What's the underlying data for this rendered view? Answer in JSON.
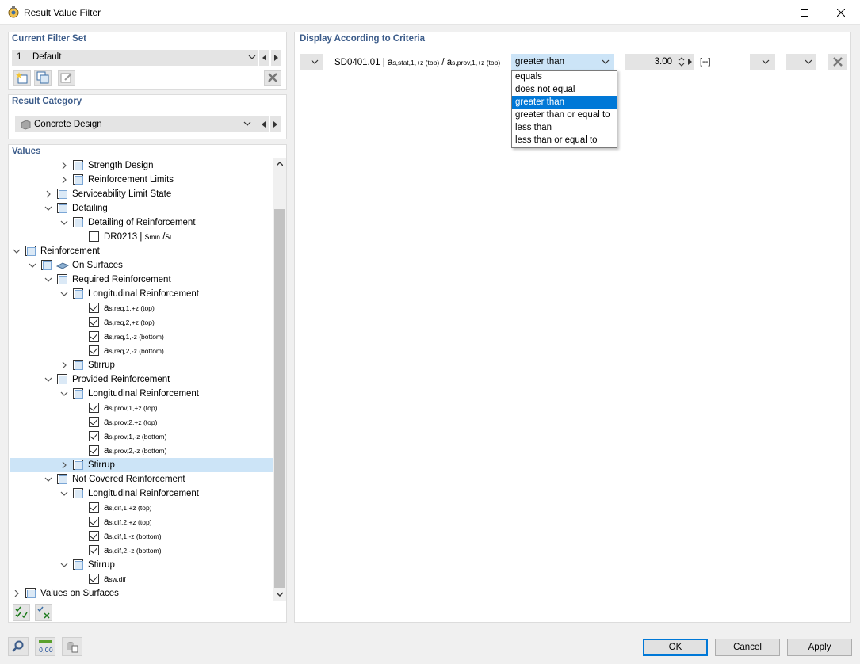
{
  "window": {
    "title": "Result Value Filter"
  },
  "current_filter_set": {
    "heading": "Current Filter Set",
    "number": "1",
    "name": "Default"
  },
  "result_category": {
    "heading": "Result Category",
    "value": "Concrete Design"
  },
  "values": {
    "heading": "Values",
    "tree": [
      {
        "label": "Strength Design",
        "expand": "collapsed",
        "check": "partial"
      },
      {
        "label": "Reinforcement Limits",
        "expand": "collapsed",
        "check": "partial"
      },
      {
        "label": "Serviceability Limit State",
        "expand": "collapsed",
        "check": "partial"
      },
      {
        "label": "Detailing",
        "expand": "expanded",
        "check": "partial"
      },
      {
        "label": "Detailing of Reinforcement",
        "expand": "expanded",
        "check": "partial"
      },
      {
        "label": "DR0213 | ",
        "sym": "s",
        "sub": "min",
        "tail": " /s",
        "tail_sub": "l",
        "check": "unchecked"
      },
      {
        "label": "Reinforcement",
        "expand": "expanded",
        "check": "partial"
      },
      {
        "label": "On Surfaces",
        "expand": "expanded",
        "check": "partial"
      },
      {
        "label": "Required Reinforcement",
        "expand": "expanded",
        "check": "partial"
      },
      {
        "label": "Longitudinal Reinforcement",
        "expand": "expanded",
        "check": "partial"
      },
      {
        "sym": "a",
        "sub": "s,req,1,+z (top)",
        "check": "checked"
      },
      {
        "sym": "a",
        "sub": "s,req,2,+z (top)",
        "check": "checked"
      },
      {
        "sym": "a",
        "sub": "s,req,1,-z (bottom)",
        "check": "checked"
      },
      {
        "sym": "a",
        "sub": "s,req,2,-z (bottom)",
        "check": "checked"
      },
      {
        "label": "Stirrup",
        "expand": "collapsed",
        "check": "partial"
      },
      {
        "label": "Provided Reinforcement",
        "expand": "expanded",
        "check": "partial"
      },
      {
        "label": "Longitudinal Reinforcement",
        "expand": "expanded",
        "check": "partial"
      },
      {
        "sym": "a",
        "sub": "s,prov,1,+z (top)",
        "check": "checked"
      },
      {
        "sym": "a",
        "sub": "s,prov,2,+z (top)",
        "check": "checked"
      },
      {
        "sym": "a",
        "sub": "s,prov,1,-z (bottom)",
        "check": "checked"
      },
      {
        "sym": "a",
        "sub": "s,prov,2,-z (bottom)",
        "check": "checked"
      },
      {
        "label": "Stirrup",
        "expand": "collapsed",
        "check": "partial",
        "selected": true
      },
      {
        "label": "Not Covered Reinforcement",
        "expand": "expanded",
        "check": "partial"
      },
      {
        "label": "Longitudinal Reinforcement",
        "expand": "expanded",
        "check": "partial"
      },
      {
        "sym": "a",
        "sub": "s,dif,1,+z (top)",
        "check": "checked"
      },
      {
        "sym": "a",
        "sub": "s,dif,2,+z (top)",
        "check": "checked"
      },
      {
        "sym": "a",
        "sub": "s,dif,1,-z (bottom)",
        "check": "checked"
      },
      {
        "sym": "a",
        "sub": "s,dif,2,-z (bottom)",
        "check": "checked"
      },
      {
        "label": "Stirrup",
        "expand": "expanded",
        "check": "partial"
      },
      {
        "sym": "a",
        "sub": "sw,dif",
        "check": "checked"
      },
      {
        "label": "Values on Surfaces",
        "expand": "collapsed",
        "check": "partial"
      }
    ]
  },
  "criteria": {
    "heading": "Display According to Criteria",
    "code": "SD0401.01 | ",
    "sym1": "a",
    "sub1": "s,stat,1,+z (top)",
    "separator": " / ",
    "sym2": "a",
    "sub2": "s,prov,1,+z (top)",
    "operator": "greater than",
    "value": "3.00",
    "unit": "[--]",
    "operator_options": [
      "equals",
      "does not equal",
      "greater than",
      "greater than or equal to",
      "less than",
      "less than or equal to"
    ],
    "selected_index": 2
  },
  "buttons": {
    "ok": "OK",
    "cancel": "Cancel",
    "apply": "Apply"
  },
  "icons": [
    "app-icon",
    "minimize-icon",
    "maximize-icon",
    "close-icon",
    "new-filter-icon",
    "copy-filter-icon",
    "rename-filter-icon",
    "delete-icon",
    "concrete-design-icon",
    "surface-icon",
    "check-all-icon",
    "uncheck-icon",
    "search-icon",
    "number-format-icon",
    "units-icon"
  ],
  "colors": {
    "heading": "#3c5c8a",
    "selection": "#0078d7",
    "tree_selection": "#cce4f7"
  }
}
